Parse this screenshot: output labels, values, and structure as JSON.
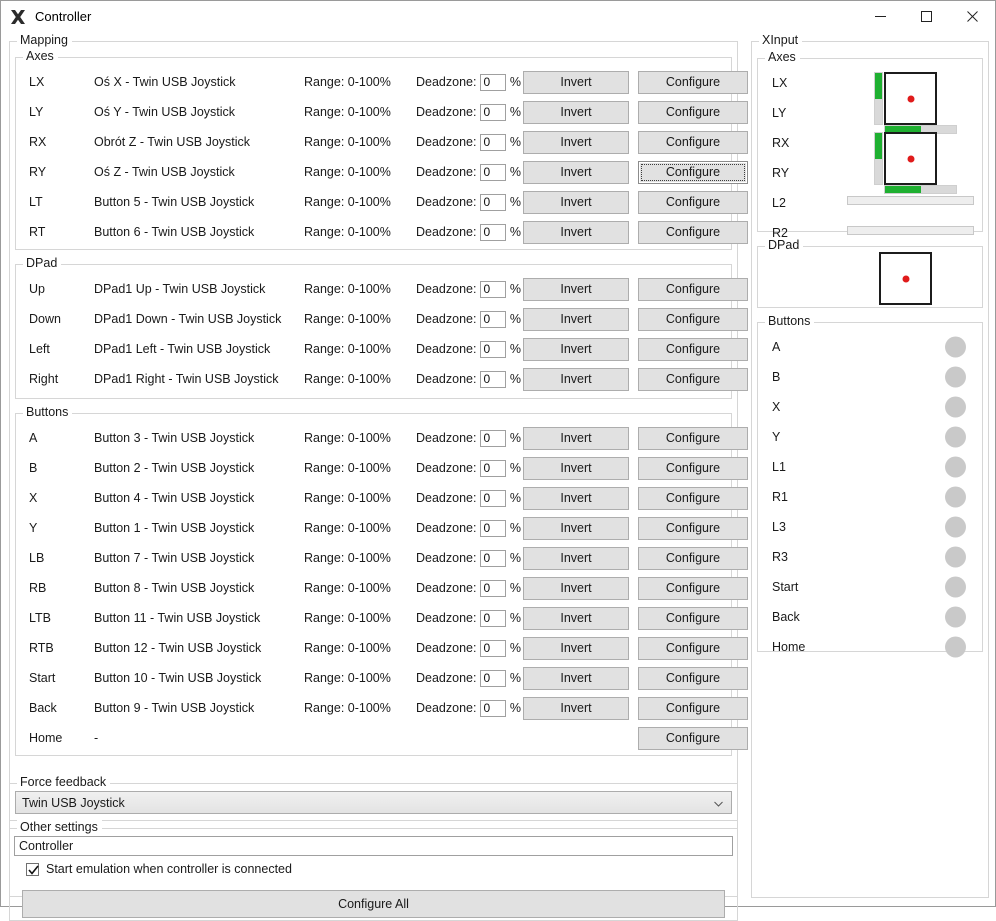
{
  "window": {
    "title": "Controller",
    "icon": "x-logo-icon",
    "controls": {
      "minimize": "minimize-icon",
      "maximize": "maximize-icon",
      "close": "close-icon"
    }
  },
  "mapping": {
    "title": "Mapping",
    "labels": {
      "range_prefix": "Range:",
      "deadzone_prefix": "Deadzone:",
      "percent": "%",
      "invert": "Invert",
      "configure": "Configure",
      "empty_mapping": "-"
    },
    "axes": {
      "title": "Axes",
      "rows": [
        {
          "key": "LX",
          "mapping": "Oś X - Twin USB Joystick",
          "range": "Range: 0-100%",
          "deadzone": "0",
          "invert": "Invert",
          "configure": "Configure",
          "focused": false
        },
        {
          "key": "LY",
          "mapping": "Oś Y - Twin USB Joystick",
          "range": "Range: 0-100%",
          "deadzone": "0",
          "invert": "Invert",
          "configure": "Configure",
          "focused": false
        },
        {
          "key": "RX",
          "mapping": "Obrót Z - Twin USB Joystick",
          "range": "Range: 0-100%",
          "deadzone": "0",
          "invert": "Invert",
          "configure": "Configure",
          "focused": false
        },
        {
          "key": "RY",
          "mapping": "Oś Z - Twin USB Joystick",
          "range": "Range: 0-100%",
          "deadzone": "0",
          "invert": "Invert",
          "configure": "Configure",
          "focused": true
        },
        {
          "key": "LT",
          "mapping": "Button 5 - Twin USB Joystick",
          "range": "Range: 0-100%",
          "deadzone": "0",
          "invert": "Invert",
          "configure": "Configure",
          "focused": false
        },
        {
          "key": "RT",
          "mapping": "Button 6 - Twin USB Joystick",
          "range": "Range: 0-100%",
          "deadzone": "0",
          "invert": "Invert",
          "configure": "Configure",
          "focused": false
        }
      ]
    },
    "dpad": {
      "title": "DPad",
      "rows": [
        {
          "key": "Up",
          "mapping": "DPad1 Up - Twin USB Joystick",
          "range": "Range: 0-100%",
          "deadzone": "0",
          "invert": "Invert",
          "configure": "Configure",
          "focused": false
        },
        {
          "key": "Down",
          "mapping": "DPad1 Down - Twin USB Joystick",
          "range": "Range: 0-100%",
          "deadzone": "0",
          "invert": "Invert",
          "configure": "Configure",
          "focused": false
        },
        {
          "key": "Left",
          "mapping": "DPad1 Left - Twin USB Joystick",
          "range": "Range: 0-100%",
          "deadzone": "0",
          "invert": "Invert",
          "configure": "Configure",
          "focused": false
        },
        {
          "key": "Right",
          "mapping": "DPad1 Right - Twin USB Joystick",
          "range": "Range: 0-100%",
          "deadzone": "0",
          "invert": "Invert",
          "configure": "Configure",
          "focused": false
        }
      ]
    },
    "buttons": {
      "title": "Buttons",
      "rows": [
        {
          "key": "A",
          "mapping": "Button 3 - Twin USB Joystick",
          "range": "Range: 0-100%",
          "deadzone": "0",
          "invert": "Invert",
          "configure": "Configure",
          "focused": false,
          "full": true
        },
        {
          "key": "B",
          "mapping": "Button 2 - Twin USB Joystick",
          "range": "Range: 0-100%",
          "deadzone": "0",
          "invert": "Invert",
          "configure": "Configure",
          "focused": false,
          "full": true
        },
        {
          "key": "X",
          "mapping": "Button 4 - Twin USB Joystick",
          "range": "Range: 0-100%",
          "deadzone": "0",
          "invert": "Invert",
          "configure": "Configure",
          "focused": false,
          "full": true
        },
        {
          "key": "Y",
          "mapping": "Button 1 - Twin USB Joystick",
          "range": "Range: 0-100%",
          "deadzone": "0",
          "invert": "Invert",
          "configure": "Configure",
          "focused": false,
          "full": true
        },
        {
          "key": "LB",
          "mapping": "Button 7 - Twin USB Joystick",
          "range": "Range: 0-100%",
          "deadzone": "0",
          "invert": "Invert",
          "configure": "Configure",
          "focused": false,
          "full": true
        },
        {
          "key": "RB",
          "mapping": "Button 8 - Twin USB Joystick",
          "range": "Range: 0-100%",
          "deadzone": "0",
          "invert": "Invert",
          "configure": "Configure",
          "focused": false,
          "full": true
        },
        {
          "key": "LTB",
          "mapping": "Button 11 - Twin USB Joystick",
          "range": "Range: 0-100%",
          "deadzone": "0",
          "invert": "Invert",
          "configure": "Configure",
          "focused": false,
          "full": true
        },
        {
          "key": "RTB",
          "mapping": "Button 12 - Twin USB Joystick",
          "range": "Range: 0-100%",
          "deadzone": "0",
          "invert": "Invert",
          "configure": "Configure",
          "focused": false,
          "full": true
        },
        {
          "key": "Start",
          "mapping": "Button 10 - Twin USB Joystick",
          "range": "Range: 0-100%",
          "deadzone": "0",
          "invert": "Invert",
          "configure": "Configure",
          "focused": false,
          "full": true
        },
        {
          "key": "Back",
          "mapping": "Button 9 - Twin USB Joystick",
          "range": "Range: 0-100%",
          "deadzone": "0",
          "invert": "Invert",
          "configure": "Configure",
          "focused": false,
          "full": true
        },
        {
          "key": "Home",
          "mapping": "-",
          "range": "",
          "deadzone": "",
          "invert": "",
          "configure": "Configure",
          "focused": false,
          "full": false
        }
      ]
    }
  },
  "force_feedback": {
    "title": "Force feedback",
    "selected_device": "Twin USB Joystick"
  },
  "other_settings": {
    "title": "Other settings",
    "controller_name": "Controller",
    "start_emulation_label": "Start emulation when controller is connected",
    "start_emulation_checked": true,
    "configure_all_label": "Configure All"
  },
  "xinput": {
    "title": "XInput",
    "axes": {
      "title": "Axes",
      "rows": [
        "LX",
        "LY",
        "RX",
        "RY",
        "L2",
        "R2"
      ],
      "left_stick": {
        "x_percent": 50,
        "y_percent": 50,
        "vbar_fill_percent": 50,
        "hbar_fill_percent": 50
      },
      "right_stick": {
        "x_percent": 50,
        "y_percent": 50,
        "vbar_fill_percent": 50,
        "hbar_fill_percent": 50
      },
      "l2_value_percent": 0,
      "r2_value_percent": 0
    },
    "dpad": {
      "title": "DPad",
      "x_percent": 50,
      "y_percent": 50
    },
    "buttons": {
      "title": "Buttons",
      "rows": [
        {
          "label": "A",
          "active": false
        },
        {
          "label": "B",
          "active": false
        },
        {
          "label": "X",
          "active": false
        },
        {
          "label": "Y",
          "active": false
        },
        {
          "label": "L1",
          "active": false
        },
        {
          "label": "R1",
          "active": false
        },
        {
          "label": "L3",
          "active": false
        },
        {
          "label": "R3",
          "active": false
        },
        {
          "label": "Start",
          "active": false
        },
        {
          "label": "Back",
          "active": false
        },
        {
          "label": "Home",
          "active": false
        }
      ]
    }
  },
  "colors": {
    "accent_green": "#1fb031",
    "indicator_red": "#e01b1b",
    "button_face": "#e1e1e1",
    "led_off": "#c9c9c9"
  }
}
